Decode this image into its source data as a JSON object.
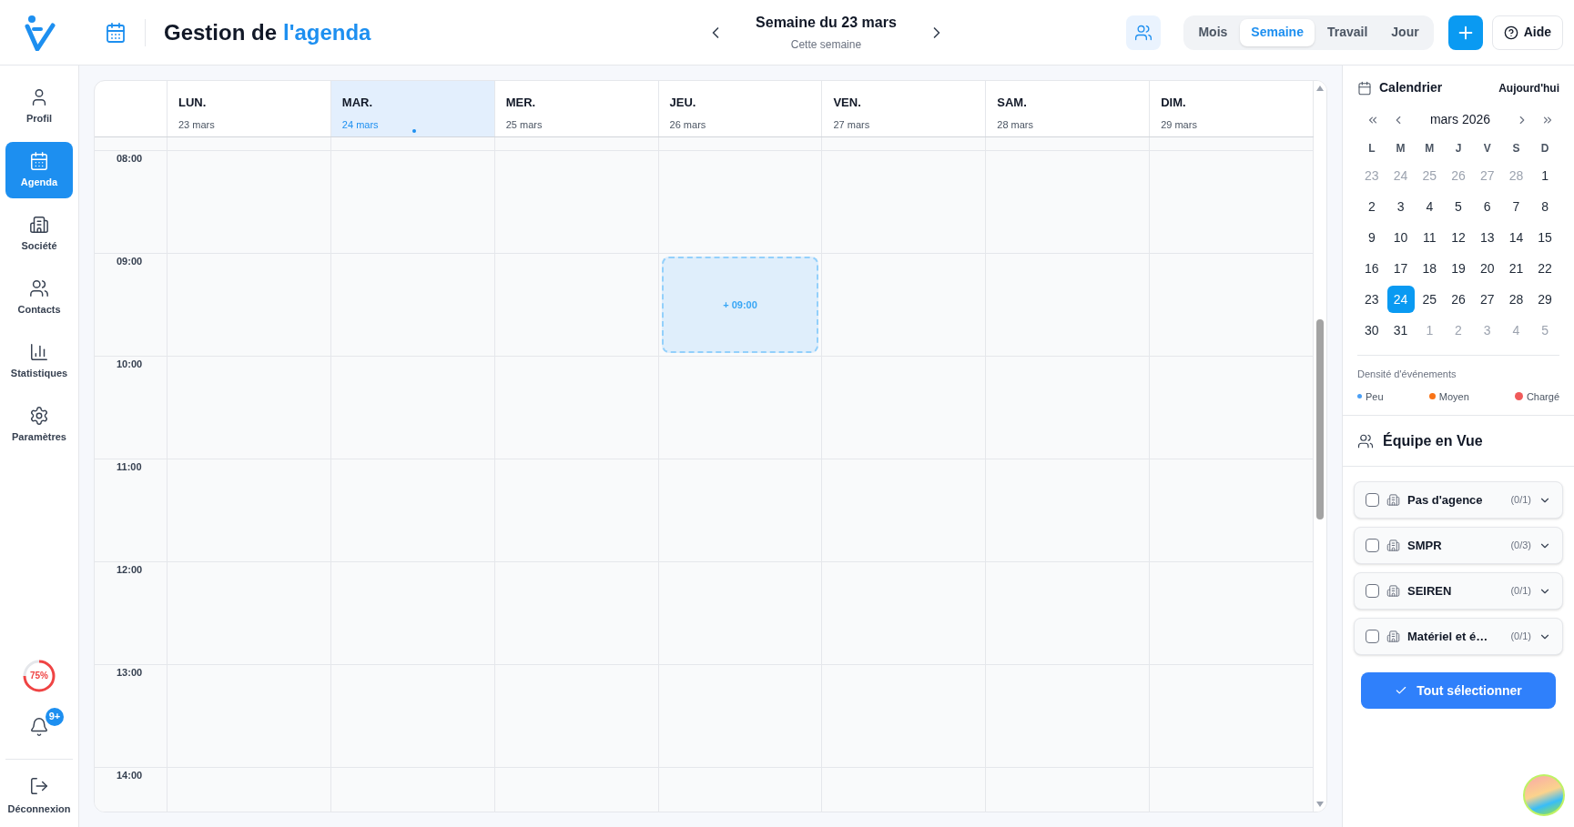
{
  "header": {
    "title": "Gestion de",
    "title_highlight": "l'agenda",
    "week_title": "Semaine du 23 mars",
    "week_subtitle": "Cette semaine",
    "views": [
      {
        "label": "Mois",
        "selected": false
      },
      {
        "label": "Semaine",
        "selected": true
      },
      {
        "label": "Travail",
        "selected": false
      },
      {
        "label": "Jour",
        "selected": false
      }
    ],
    "help_button": "Aide"
  },
  "sidebar": {
    "items": [
      {
        "label": "Profil",
        "selected": false
      },
      {
        "label": "Agenda",
        "selected": true
      },
      {
        "label": "Société",
        "selected": false
      },
      {
        "label": "Contacts",
        "selected": false
      },
      {
        "label": "Statistiques",
        "selected": false
      },
      {
        "label": "Paramètres",
        "selected": false
      }
    ],
    "progress": {
      "label": "75%",
      "level": 0.75
    },
    "notifications_badge": "9+",
    "logout": "Déconnexion"
  },
  "calendar": {
    "days": [
      {
        "name": "LUN.",
        "date": "23 mars",
        "selected": false
      },
      {
        "name": "MAR.",
        "date": "24 mars",
        "selected": true
      },
      {
        "name": "MER.",
        "date": "25 mars",
        "selected": false
      },
      {
        "name": "JEU.",
        "date": "26 mars",
        "selected": false,
        "slot": {
          "label": "+ 09:00"
        }
      },
      {
        "name": "VEN.",
        "date": "27 mars",
        "selected": false
      },
      {
        "name": "SAM.",
        "date": "28 mars",
        "selected": false
      },
      {
        "name": "DIM.",
        "date": "29 mars",
        "selected": false
      }
    ],
    "hours": [
      {
        "label": "08:00",
        "slot_row": false
      },
      {
        "label": "09:00",
        "slot_row": true
      },
      {
        "label": "10:00",
        "slot_row": false
      },
      {
        "label": "11:00",
        "slot_row": false
      },
      {
        "label": "12:00",
        "slot_row": false
      },
      {
        "label": "13:00",
        "slot_row": false
      },
      {
        "label": "14:00",
        "slot_row": false
      }
    ]
  },
  "mini_calendar": {
    "title": "Calendrier",
    "today_button": "Aujourd'hui",
    "month": "mars 2026",
    "weekdays": [
      "L",
      "M",
      "M",
      "J",
      "V",
      "S",
      "D"
    ],
    "weeks": [
      [
        {
          "label": "23",
          "outside": true,
          "selected": false
        },
        {
          "label": "24",
          "outside": true,
          "selected": false
        },
        {
          "label": "25",
          "outside": true,
          "selected": false
        },
        {
          "label": "26",
          "outside": true,
          "selected": false
        },
        {
          "label": "27",
          "outside": true,
          "selected": false
        },
        {
          "label": "28",
          "outside": true,
          "selected": false
        },
        {
          "label": "1",
          "outside": false,
          "selected": false
        }
      ],
      [
        {
          "label": "2",
          "outside": false,
          "selected": false
        },
        {
          "label": "3",
          "outside": false,
          "selected": false
        },
        {
          "label": "4",
          "outside": false,
          "selected": false
        },
        {
          "label": "5",
          "outside": false,
          "selected": false
        },
        {
          "label": "6",
          "outside": false,
          "selected": false
        },
        {
          "label": "7",
          "outside": false,
          "selected": false
        },
        {
          "label": "8",
          "outside": false,
          "selected": false
        }
      ],
      [
        {
          "label": "9",
          "outside": false,
          "selected": false
        },
        {
          "label": "10",
          "outside": false,
          "selected": false
        },
        {
          "label": "11",
          "outside": false,
          "selected": false
        },
        {
          "label": "12",
          "outside": false,
          "selected": false
        },
        {
          "label": "13",
          "outside": false,
          "selected": false
        },
        {
          "label": "14",
          "outside": false,
          "selected": false
        },
        {
          "label": "15",
          "outside": false,
          "selected": false
        }
      ],
      [
        {
          "label": "16",
          "outside": false,
          "selected": false
        },
        {
          "label": "17",
          "outside": false,
          "selected": false
        },
        {
          "label": "18",
          "outside": false,
          "selected": false
        },
        {
          "label": "19",
          "outside": false,
          "selected": false
        },
        {
          "label": "20",
          "outside": false,
          "selected": false
        },
        {
          "label": "21",
          "outside": false,
          "selected": false
        },
        {
          "label": "22",
          "outside": false,
          "selected": false
        }
      ],
      [
        {
          "label": "23",
          "outside": false,
          "selected": false
        },
        {
          "label": "24",
          "outside": false,
          "selected": true
        },
        {
          "label": "25",
          "outside": false,
          "selected": false
        },
        {
          "label": "26",
          "outside": false,
          "selected": false
        },
        {
          "label": "27",
          "outside": false,
          "selected": false
        },
        {
          "label": "28",
          "outside": false,
          "selected": false
        },
        {
          "label": "29",
          "outside": false,
          "selected": false
        }
      ],
      [
        {
          "label": "30",
          "outside": false,
          "selected": false
        },
        {
          "label": "31",
          "outside": false,
          "selected": false
        },
        {
          "label": "1",
          "outside": true,
          "selected": false
        },
        {
          "label": "2",
          "outside": true,
          "selected": false
        },
        {
          "label": "3",
          "outside": true,
          "selected": false
        },
        {
          "label": "4",
          "outside": true,
          "selected": false
        },
        {
          "label": "5",
          "outside": true,
          "selected": false
        }
      ]
    ],
    "density_title": "Densité d'événements",
    "density": [
      {
        "label": "Peu",
        "color": "#4a9ff5"
      },
      {
        "label": "Moyen",
        "color": "#f97316"
      },
      {
        "label": "Chargé",
        "color": "#f05a5a"
      }
    ]
  },
  "team": {
    "title": "Équipe en Vue",
    "groups": [
      {
        "name": "Pas d'agence",
        "count": "(0/1)",
        "checked": false,
        "expanded": false
      },
      {
        "name": "SMPR",
        "count": "(0/3)",
        "checked": false,
        "expanded": false
      },
      {
        "name": "SEIREN",
        "count": "(0/1)",
        "checked": false,
        "expanded": false
      },
      {
        "name": "Matériel et é…",
        "count": "(0/1)",
        "checked": false,
        "expanded": false
      }
    ],
    "select_all": "Tout sélectionner"
  }
}
